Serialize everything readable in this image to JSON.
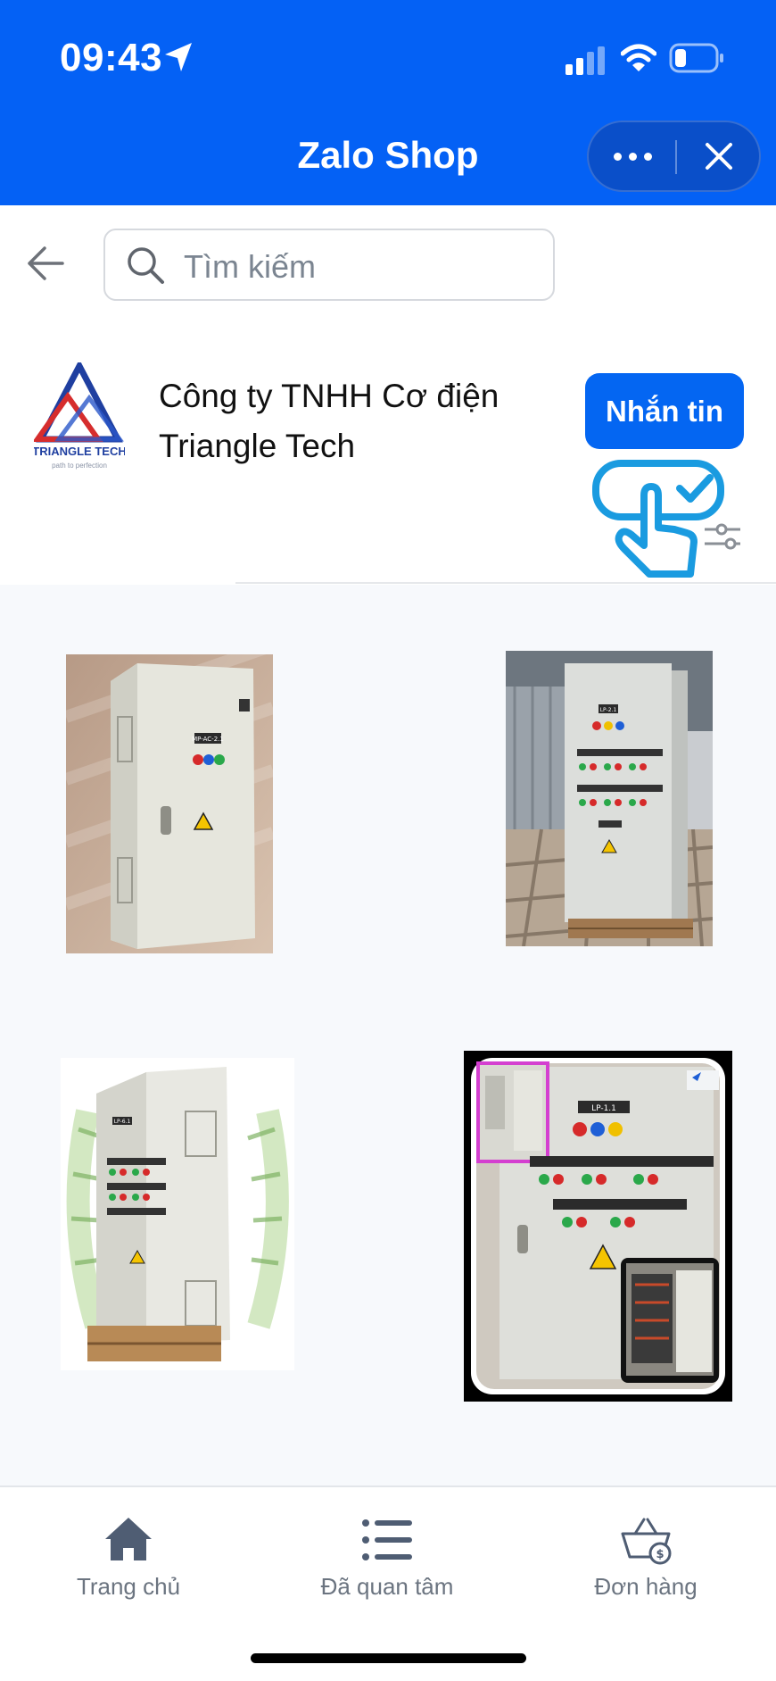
{
  "status_bar": {
    "time": "09:43"
  },
  "app_bar": {
    "title": "Zalo Shop"
  },
  "search": {
    "placeholder": "Tìm kiếm"
  },
  "shop": {
    "name_line1": "Công ty TNHH Cơ điện",
    "name_line2": "Triangle Tech",
    "logo_text": "TRIANGLE TECH",
    "message_button": "Nhắn tin"
  },
  "products": [
    {
      "label": "MP-AC-2.1"
    },
    {
      "label": "LP-2.1"
    },
    {
      "label": "LP-6.1"
    },
    {
      "label": "LP-1.1"
    }
  ],
  "bottom_nav": {
    "items": [
      {
        "label": "Trang chủ",
        "icon": "home-icon"
      },
      {
        "label": "Đã quan tâm",
        "icon": "list-icon"
      },
      {
        "label": "Đơn hàng",
        "icon": "basket-icon"
      }
    ]
  },
  "colors": {
    "primary": "#0461f5",
    "nav_text": "#6b7480"
  }
}
